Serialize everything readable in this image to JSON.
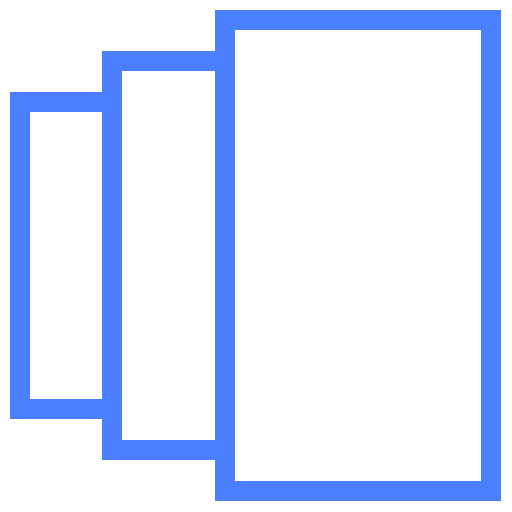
{
  "icon": {
    "name": "stacked-pages-icon",
    "stroke_color": "#4a7fff",
    "fill_color": "#ffffff"
  }
}
